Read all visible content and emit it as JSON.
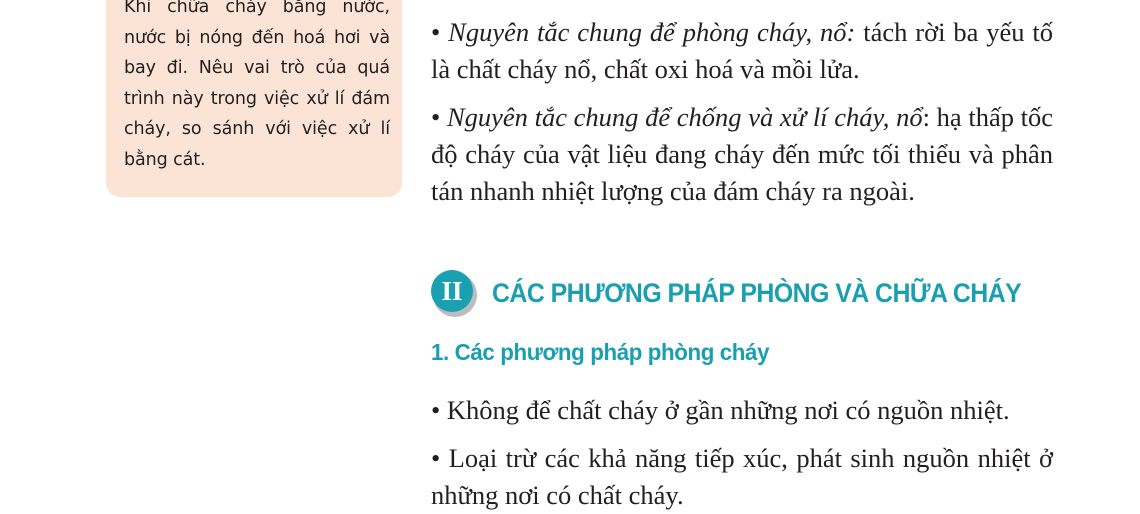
{
  "sidebar": {
    "text": "Khi chữa cháy bằng nước, nước bị nóng đến hoá hơi và bay đi. Nêu vai trò của quá trình này trong việc xử lí đám cháy, so sánh với việc xử lí bằng cát."
  },
  "principles": {
    "bullet": "•",
    "prevention_term": "Nguyên tắc chung để phòng cháy, nổ:",
    "prevention_text": " tách rời ba yếu tố là chất cháy nổ, chất oxi hoá và mồi lửa.",
    "fighting_term": "Nguyên tắc chung để chống và xử lí cháy, nổ",
    "fighting_text": ": hạ thấp tốc độ cháy của vật liệu đang cháy đến mức tối thiểu và phân tán nhanh nhiệt lượng của đám cháy ra ngoài."
  },
  "section": {
    "numeral": "II",
    "title": "CÁC PHƯƠNG PHÁP PHÒNG VÀ CHỮA CHÁY"
  },
  "subsection": {
    "title": "1. Các phương pháp phòng cháy"
  },
  "methods": {
    "bullet": "•",
    "item1": " Không để chất cháy ở gần những nơi có nguồn nhiệt.",
    "item2": " Loại trừ các khả năng tiếp xúc, phát sinh nguồn nhiệt ở những nơi có chất cháy."
  },
  "colors": {
    "heading_teal": "#1a9fb1",
    "sidebar_bg": "#fbe3d6",
    "badge_teal": "#1aa0b0"
  }
}
